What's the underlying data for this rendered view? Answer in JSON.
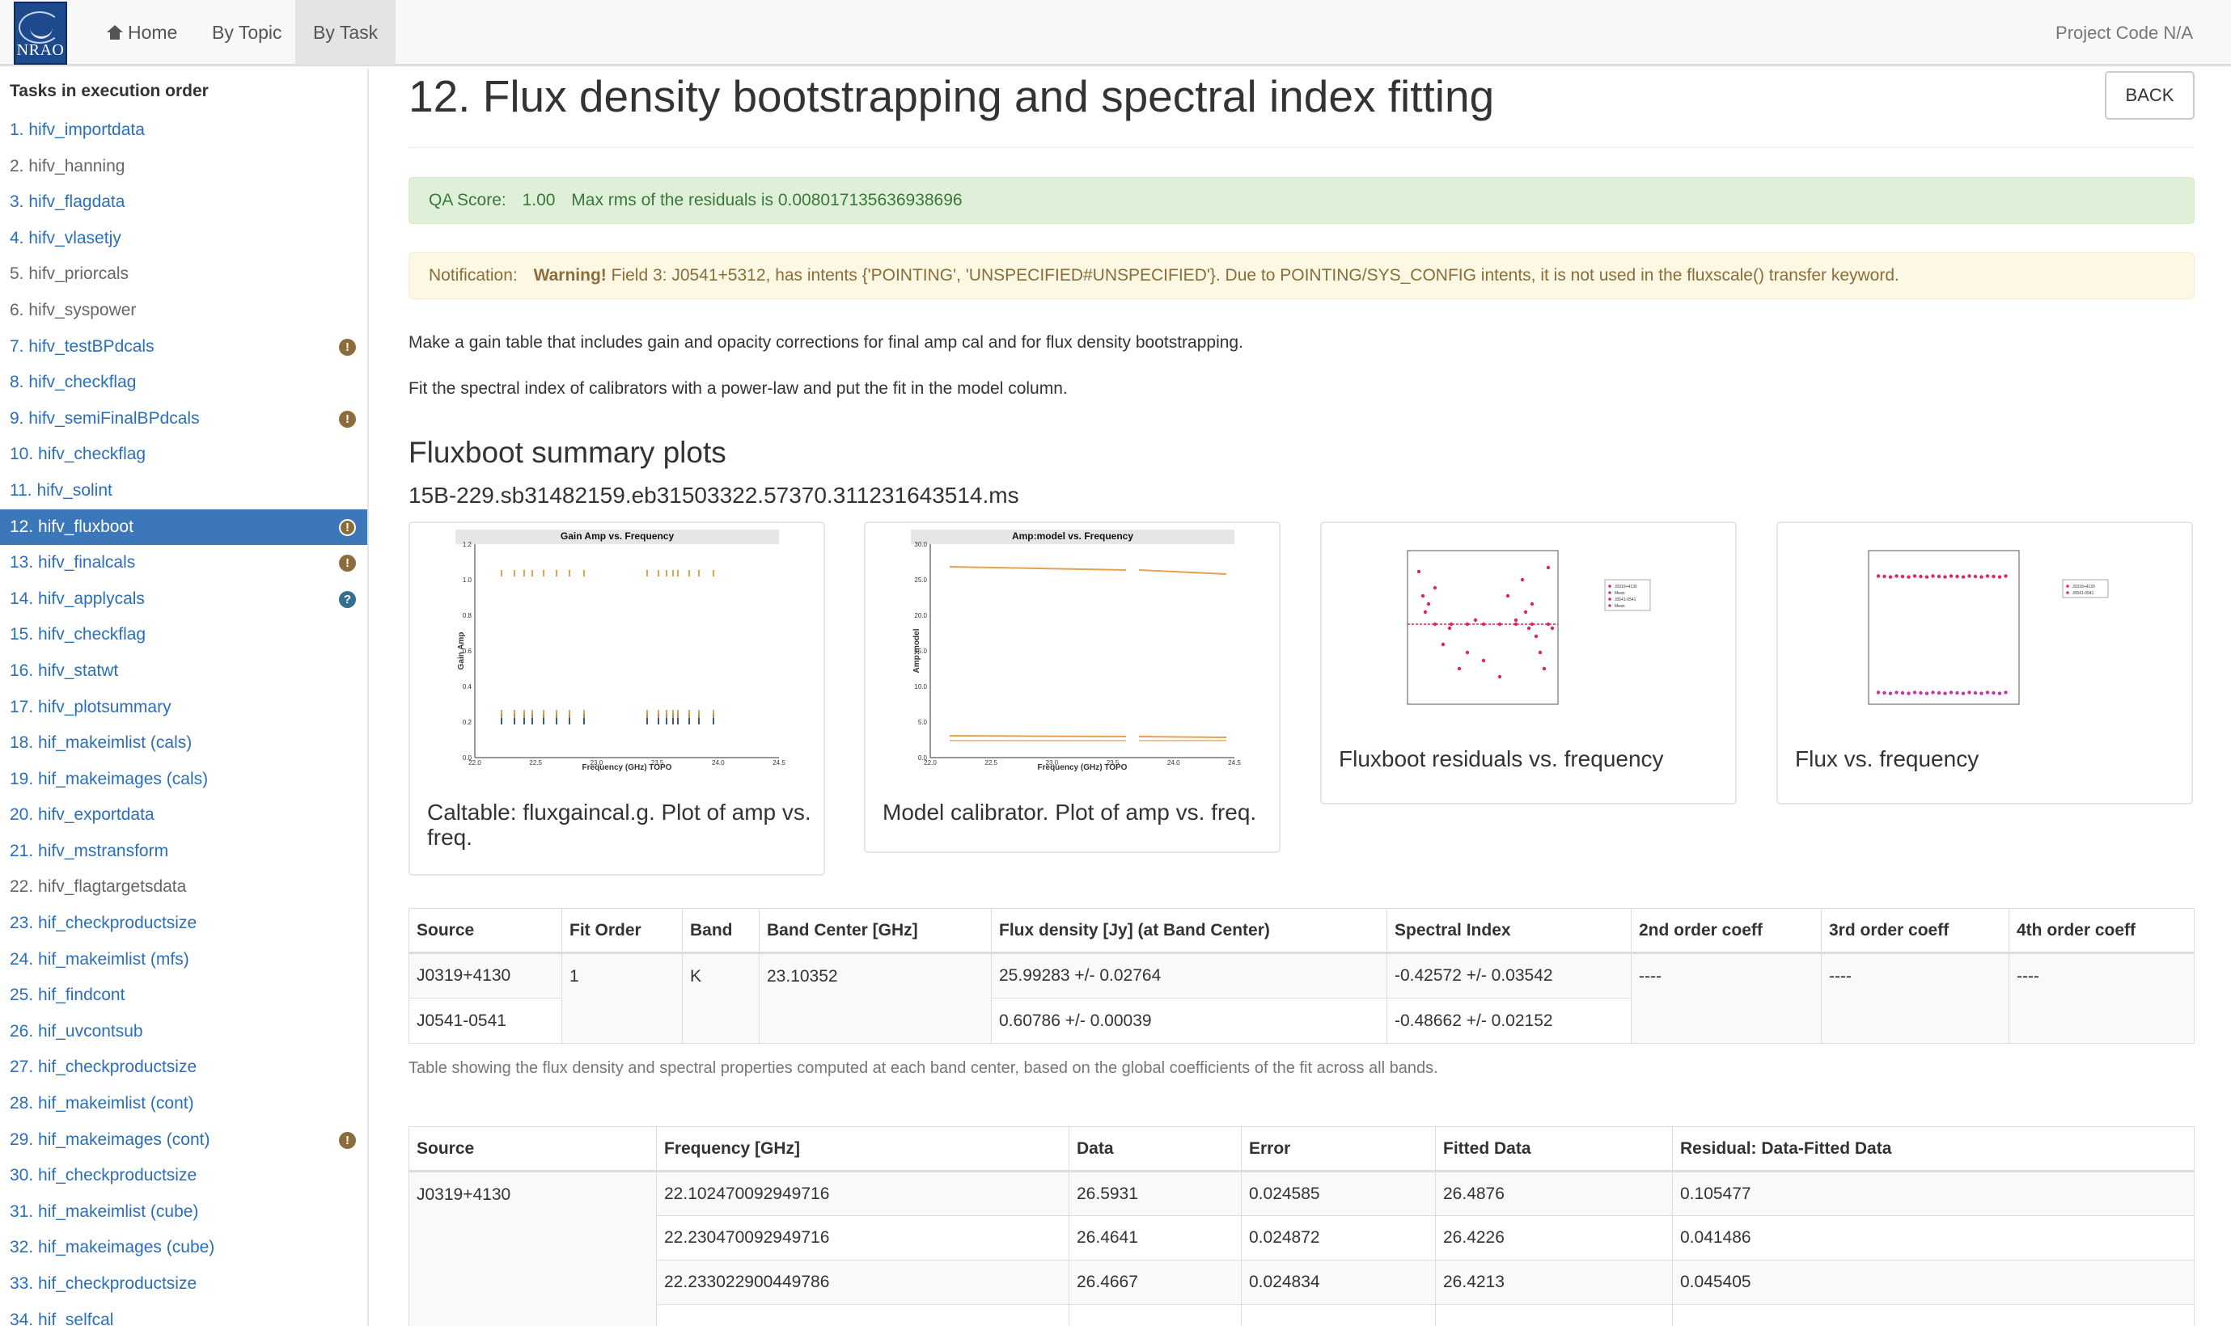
{
  "navbar": {
    "logo_text": "NRAO",
    "home_label": "Home",
    "by_topic_label": "By Topic",
    "by_task_label": "By Task",
    "project_code": "Project Code N/A"
  },
  "sidebar": {
    "heading": "Tasks in execution order",
    "items": [
      {
        "label": "1. hifv_importdata",
        "style": "link",
        "badge": ""
      },
      {
        "label": "2. hifv_hanning",
        "style": "gray",
        "badge": ""
      },
      {
        "label": "3. hifv_flagdata",
        "style": "link",
        "badge": ""
      },
      {
        "label": "4. hifv_vlasetjy",
        "style": "link",
        "badge": ""
      },
      {
        "label": "5. hifv_priorcals",
        "style": "gray",
        "badge": ""
      },
      {
        "label": "6. hifv_syspower",
        "style": "gray",
        "badge": ""
      },
      {
        "label": "7. hifv_testBPdcals",
        "style": "link",
        "badge": "warn"
      },
      {
        "label": "8. hifv_checkflag",
        "style": "link",
        "badge": ""
      },
      {
        "label": "9. hifv_semiFinalBPdcals",
        "style": "link",
        "badge": "warn"
      },
      {
        "label": "10. hifv_checkflag",
        "style": "link",
        "badge": ""
      },
      {
        "label": "11. hifv_solint",
        "style": "link",
        "badge": ""
      },
      {
        "label": "12. hifv_fluxboot",
        "style": "active",
        "badge": "warn"
      },
      {
        "label": "13. hifv_finalcals",
        "style": "link",
        "badge": "warn"
      },
      {
        "label": "14. hifv_applycals",
        "style": "link",
        "badge": "info"
      },
      {
        "label": "15. hifv_checkflag",
        "style": "link",
        "badge": ""
      },
      {
        "label": "16. hifv_statwt",
        "style": "link",
        "badge": ""
      },
      {
        "label": "17. hifv_plotsummary",
        "style": "link",
        "badge": ""
      },
      {
        "label": "18. hif_makeimlist (cals)",
        "style": "link",
        "badge": ""
      },
      {
        "label": "19. hif_makeimages (cals)",
        "style": "link",
        "badge": ""
      },
      {
        "label": "20. hifv_exportdata",
        "style": "link",
        "badge": ""
      },
      {
        "label": "21. hifv_mstransform",
        "style": "link",
        "badge": ""
      },
      {
        "label": "22. hifv_flagtargetsdata",
        "style": "gray",
        "badge": ""
      },
      {
        "label": "23. hif_checkproductsize",
        "style": "link",
        "badge": ""
      },
      {
        "label": "24. hif_makeimlist (mfs)",
        "style": "link",
        "badge": ""
      },
      {
        "label": "25. hif_findcont",
        "style": "link",
        "badge": ""
      },
      {
        "label": "26. hif_uvcontsub",
        "style": "link",
        "badge": ""
      },
      {
        "label": "27. hif_checkproductsize",
        "style": "link",
        "badge": ""
      },
      {
        "label": "28. hif_makeimlist (cont)",
        "style": "link",
        "badge": ""
      },
      {
        "label": "29. hif_makeimages (cont)",
        "style": "link",
        "badge": "warn"
      },
      {
        "label": "30. hif_checkproductsize",
        "style": "link",
        "badge": ""
      },
      {
        "label": "31. hif_makeimlist (cube)",
        "style": "link",
        "badge": ""
      },
      {
        "label": "32. hif_makeimages (cube)",
        "style": "link",
        "badge": ""
      },
      {
        "label": "33. hif_checkproductsize",
        "style": "link",
        "badge": ""
      },
      {
        "label": "34. hif_selfcal",
        "style": "link",
        "badge": ""
      }
    ]
  },
  "page": {
    "title": "12. Flux density bootstrapping and spectral index fitting",
    "back_label": "BACK",
    "qa": {
      "label": "QA Score:",
      "score": "1.00",
      "message": "Max rms of the residuals is 0.008017135636938696"
    },
    "notification": {
      "label": "Notification:",
      "strong": "Warning!",
      "message": "Field 3: J0541+5312, has intents {'POINTING', 'UNSPECIFIED#UNSPECIFIED'}. Due to POINTING/SYS_CONFIG intents, it is not used in the fluxscale() transfer keyword."
    },
    "description_1": "Make a gain table that includes gain and opacity corrections for final amp cal and for flux density bootstrapping.",
    "description_2": "Fit the spectral index of calibrators with a power-law and put the fit in the model column.",
    "section_title": "Fluxboot summary plots",
    "ms_name": "15B-229.sb31482159.eb31503322.57370.311231643514.ms"
  },
  "thumbnails": [
    {
      "caption": "Caltable: fluxgaincal.g. Plot of amp vs. freq.",
      "plot_title": "Gain Amp vs. Frequency",
      "xlabel": "Frequency (GHz) TOPO",
      "ylabel": "Gain Amp",
      "xticks": [
        "22.0",
        "22.5",
        "23.0",
        "23.5",
        "24.0",
        "24.5"
      ],
      "yticks": [
        "0.0",
        "0.2",
        "0.4",
        "0.6",
        "0.8",
        "1.0",
        "1.2"
      ]
    },
    {
      "caption": "Model calibrator. Plot of amp vs. freq.",
      "plot_title": "Amp:model vs. Frequency",
      "xlabel": "Frequency (GHz) TOPO",
      "ylabel": "Amp:model",
      "xticks": [
        "22.0",
        "22.5",
        "23.0",
        "23.5",
        "24.0",
        "24.5"
      ],
      "yticks": [
        "0.0",
        "5.0",
        "10.0",
        "15.0",
        "20.0",
        "25.0",
        "30.0"
      ]
    },
    {
      "caption": "Fluxboot residuals vs. frequency",
      "legend": [
        "J0319+4130",
        "Mean",
        "J0541-0541",
        "Mean"
      ]
    },
    {
      "caption": "Flux vs. frequency",
      "legend": [
        "J0319+4130",
        "J0541-0541"
      ]
    }
  ],
  "flux_table": {
    "headers": [
      "Source",
      "Fit Order",
      "Band",
      "Band Center [GHz]",
      "Flux density [Jy] (at Band Center)",
      "Spectral Index",
      "2nd order coeff",
      "3rd order coeff",
      "4th order coeff"
    ],
    "fit_order": "1",
    "band": "K",
    "band_center": "23.10352",
    "coeff_2": "----",
    "coeff_3": "----",
    "coeff_4": "----",
    "rows": [
      {
        "source": "J0319+4130",
        "flux": "25.99283 +/- 0.02764",
        "spix": "-0.42572 +/- 0.03542"
      },
      {
        "source": "J0541-0541",
        "flux": "0.60786 +/- 0.00039",
        "spix": "-0.48662 +/- 0.02152"
      }
    ],
    "note": "Table showing the flux density and spectral properties computed at each band center, based on the global coefficients of the fit across all bands."
  },
  "residual_table": {
    "headers": [
      "Source",
      "Frequency [GHz]",
      "Data",
      "Error",
      "Fitted Data",
      "Residual: Data-Fitted Data"
    ],
    "source": "J0319+4130",
    "rows": [
      {
        "freq": "22.102470092949716",
        "data": "26.5931",
        "error": "0.024585",
        "fitted": "26.4876",
        "residual": "0.105477"
      },
      {
        "freq": "22.230470092949716",
        "data": "26.4641",
        "error": "0.024872",
        "fitted": "26.4226",
        "residual": "0.041486"
      },
      {
        "freq": "22.233022900449786",
        "data": "26.4667",
        "error": "0.024834",
        "fitted": "26.4213",
        "residual": "0.045405"
      }
    ]
  },
  "colors": {
    "link": "#2a6ebb",
    "active_bg": "#3b77b9",
    "success_bg": "#dff0d8",
    "warning_bg": "#fcf8e3",
    "gain_points": "#e8a04a",
    "residual_points": "#e0245e",
    "flux_points_2": "#c2379c"
  }
}
